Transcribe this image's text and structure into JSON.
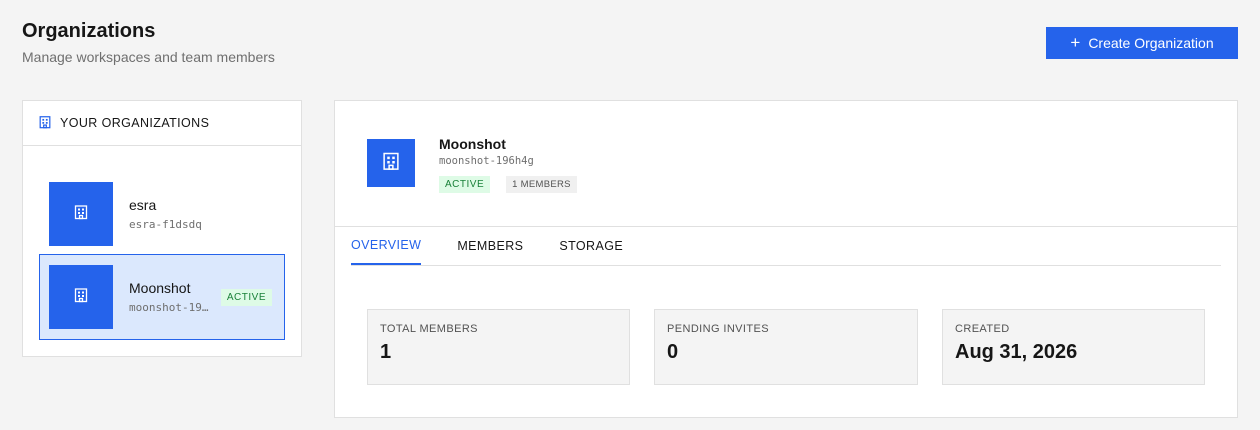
{
  "header": {
    "title": "Organizations",
    "subtitle": "Manage workspaces and team members",
    "create_button_label": "Create Organization"
  },
  "sidebar": {
    "title": "YOUR ORGANIZATIONS",
    "organizations": [
      {
        "name": "esra",
        "slug": "esra-f1dsdq",
        "badge": ""
      },
      {
        "name": "Moonshot",
        "slug": "moonshot-19…",
        "badge": "ACTIVE"
      }
    ]
  },
  "detail": {
    "name": "Moonshot",
    "slug": "moonshot-196h4g",
    "status_badge": "ACTIVE",
    "members_badge": "1 MEMBERS",
    "tabs": [
      {
        "label": "OVERVIEW",
        "active": true
      },
      {
        "label": "MEMBERS",
        "active": false
      },
      {
        "label": "STORAGE",
        "active": false
      }
    ],
    "stats": [
      {
        "label": "TOTAL MEMBERS",
        "value": "1"
      },
      {
        "label": "PENDING INVITES",
        "value": "0"
      },
      {
        "label": "CREATED",
        "value": "Aug 31, 2026"
      }
    ]
  },
  "colors": {
    "accent": "#2563eb",
    "active_badge_bg": "#defbe6",
    "active_badge_text": "#198038"
  },
  "icons": {
    "header_icon": "building-icon",
    "org_logo_icon": "building-icon",
    "create_icon": "plus-icon"
  }
}
